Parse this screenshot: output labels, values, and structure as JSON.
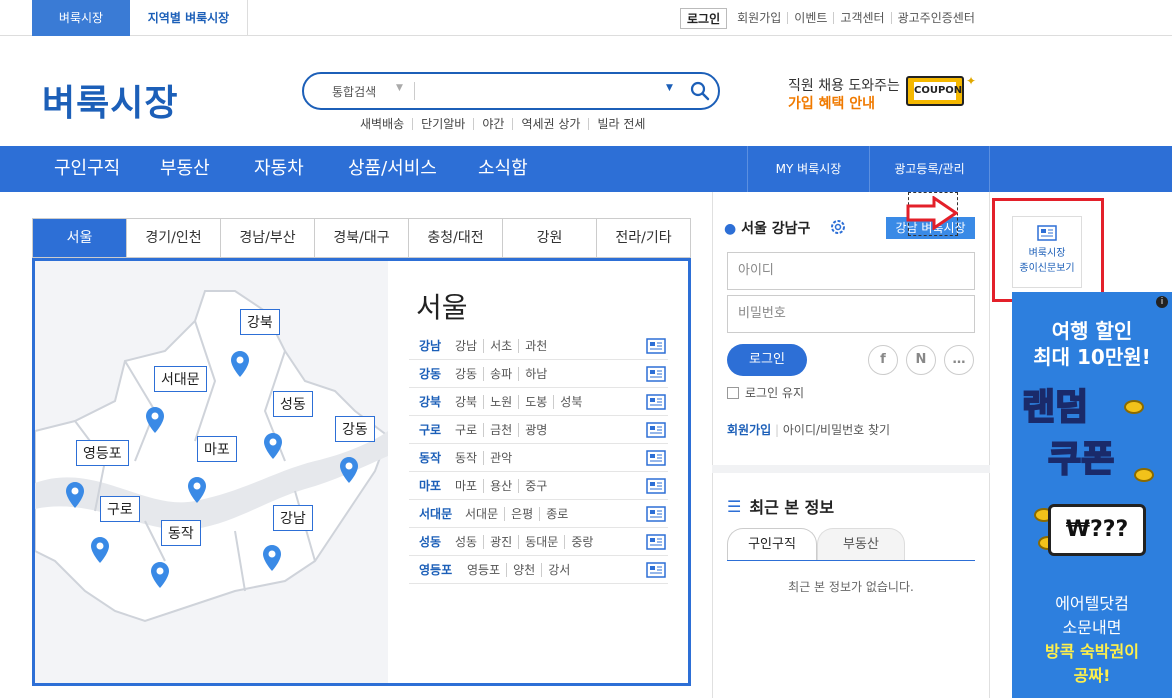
{
  "topbar": {
    "tab_market": "벼룩시장",
    "tab_regional": "지역별 벼룩시장",
    "login": "로그인",
    "links": [
      "회원가입",
      "이벤트",
      "고객센터",
      "광고주인증센터"
    ]
  },
  "header": {
    "logo": "벼룩시장",
    "search_category": "통합검색",
    "search_value": "",
    "keywords": [
      "새벽배송",
      "단기알바",
      "야간",
      "역세권 상가",
      "빌라 전세"
    ],
    "promo_line1": "직원 채용 도와주는",
    "promo_line2": "가입 혜택 안내",
    "coupon": "COUPON"
  },
  "nav": {
    "items": [
      "구인구직",
      "부동산",
      "자동차",
      "상품/서비스",
      "소식함"
    ],
    "right": [
      "MY 벼룩시장",
      "광고등록/관리"
    ]
  },
  "regions": {
    "tabs": [
      "서울",
      "경기/인천",
      "경남/부산",
      "경북/대구",
      "충청/대전",
      "강원",
      "전라/기타"
    ],
    "title": "서울",
    "map_pins": [
      "강북",
      "서대문",
      "성동",
      "강동",
      "영등포",
      "마포",
      "구로",
      "동작",
      "강남"
    ],
    "rows": [
      {
        "name": "강남",
        "subs": [
          "강남",
          "서초",
          "과천"
        ]
      },
      {
        "name": "강동",
        "subs": [
          "강동",
          "송파",
          "하남"
        ]
      },
      {
        "name": "강북",
        "subs": [
          "강북",
          "노원",
          "도봉",
          "성북"
        ]
      },
      {
        "name": "구로",
        "subs": [
          "구로",
          "금천",
          "광명"
        ]
      },
      {
        "name": "동작",
        "subs": [
          "동작",
          "관악"
        ]
      },
      {
        "name": "마포",
        "subs": [
          "마포",
          "용산",
          "중구"
        ]
      },
      {
        "name": "서대문",
        "subs": [
          "서대문",
          "은평",
          "종로"
        ]
      },
      {
        "name": "성동",
        "subs": [
          "성동",
          "광진",
          "동대문",
          "중랑"
        ]
      },
      {
        "name": "영등포",
        "subs": [
          "영등포",
          "양천",
          "강서"
        ]
      }
    ]
  },
  "login_panel": {
    "location": "서울 강남구",
    "change_button": "강남 벼룩시장",
    "id_placeholder": "아이디",
    "pw_placeholder": "비밀번호",
    "login_button": "로그인",
    "social": [
      "f",
      "N",
      "…"
    ],
    "keep_login": "로그인 유지",
    "join": "회원가입",
    "find": "아이디/비밀번호 찾기"
  },
  "recent": {
    "title": "최근 본 정보",
    "tabs": [
      "구인구직",
      "부동산"
    ],
    "empty": "최근 본 정보가 없습니다."
  },
  "paper": {
    "line1": "벼룩시장",
    "line2": "종이신문보기"
  },
  "ad": {
    "line1": "여행 할인",
    "line2": "최대 10만원!",
    "random": "랜덤",
    "coupon": "쿠폰",
    "ticket": "₩???",
    "bottom1": "에어텔닷컴",
    "bottom2": "소문내면",
    "bottom3": "방콕 숙박권이",
    "bottom4": "공짜!",
    "info": "i"
  },
  "colors": {
    "primary": "#2d6fd6",
    "logo": "#1c5fb8",
    "highlight": "#e3202a",
    "promo": "#f07a00"
  }
}
